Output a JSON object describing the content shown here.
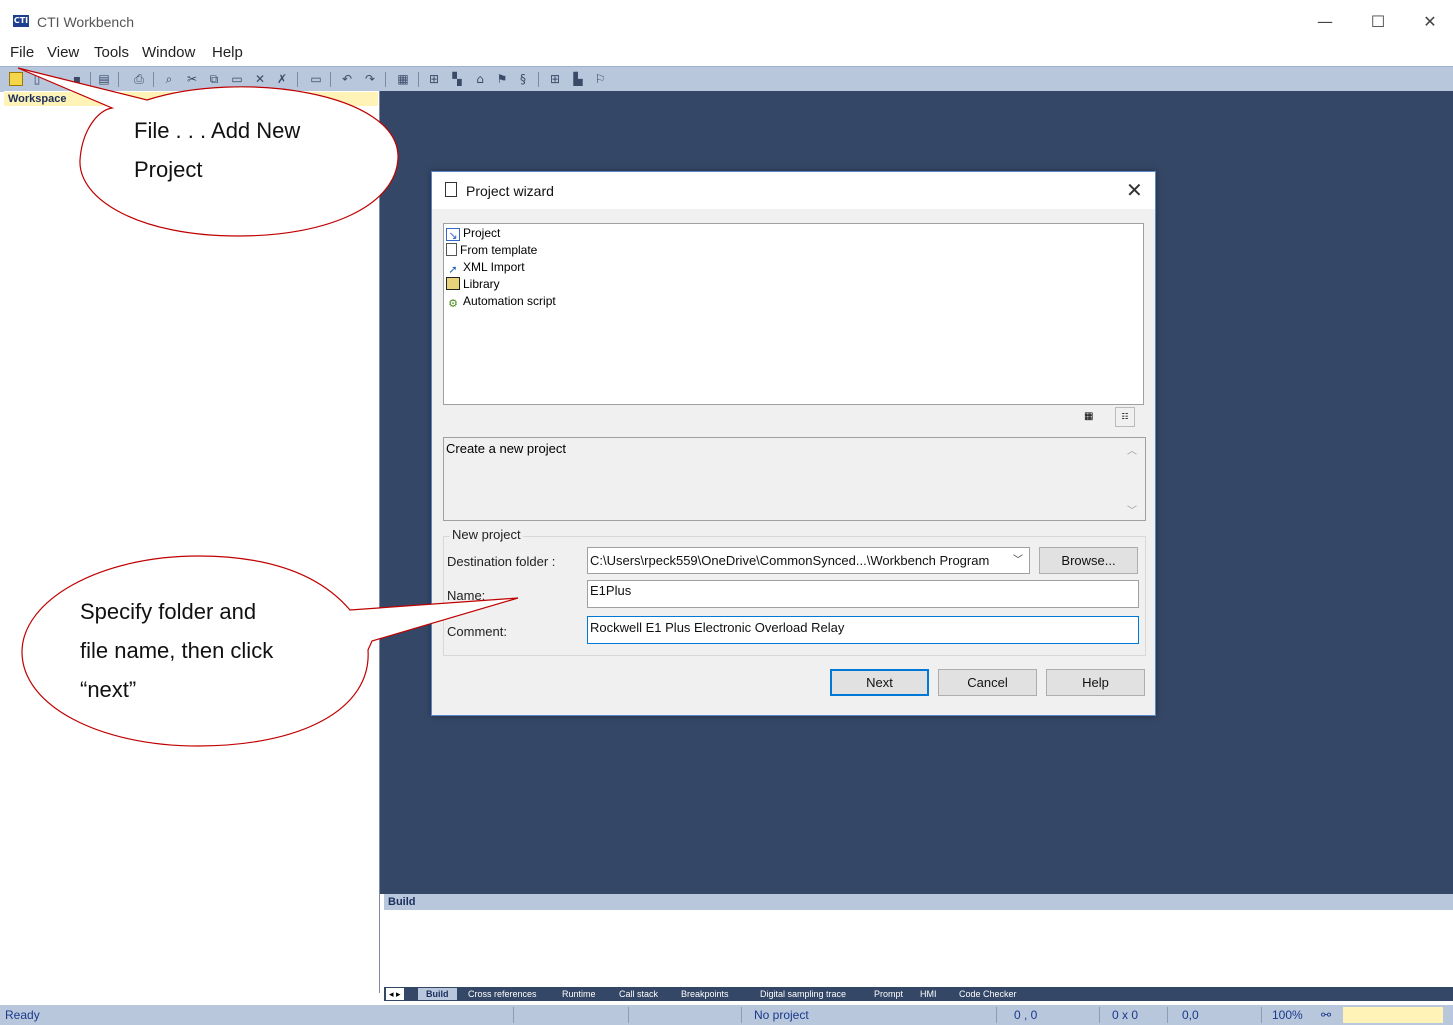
{
  "app": {
    "title": "CTI Workbench"
  },
  "window_controls": {
    "minimize": "—",
    "maximize": "☐",
    "close": "✕"
  },
  "menu": [
    "File",
    "View",
    "Tools",
    "Window",
    "Help"
  ],
  "workspace": {
    "header": "Workspace"
  },
  "build": {
    "header": "Build",
    "tabs": [
      "Build",
      "Cross references",
      "Runtime",
      "Call stack",
      "Breakpoints",
      "Digital sampling trace",
      "Prompt",
      "HMI",
      "Code Checker"
    ],
    "active_tab": "Build"
  },
  "status": {
    "ready": "Ready",
    "project": "No project",
    "coords": "0 , 0",
    "size": "0 x 0",
    "pos": "0,0",
    "zoom": "100%"
  },
  "dialog": {
    "title": "Project wizard",
    "items": [
      {
        "label": "Project",
        "icon": "project-wizard-icon"
      },
      {
        "label": "From template",
        "icon": "template-icon"
      },
      {
        "label": "XML Import",
        "icon": "xml-import-icon"
      },
      {
        "label": "Library",
        "icon": "library-icon"
      },
      {
        "label": "Automation script",
        "icon": "automation-script-icon"
      }
    ],
    "selected_item": "Project",
    "description": "Create a new project",
    "group_title": "New project",
    "destination_label": "Destination folder :",
    "destination_value": "C:\\Users\\rpeck559\\OneDrive\\CommonSynced...\\Workbench Program",
    "browse_label": "Browse...",
    "name_label": "Name:",
    "name_value": "E1Plus",
    "comment_label": "Comment:",
    "comment_value": "Rockwell E1 Plus Electronic Overload Relay",
    "next_label": "Next",
    "cancel_label": "Cancel",
    "help_label": "Help"
  },
  "callouts": {
    "top": [
      "File . . . Add New",
      "Project"
    ],
    "bottom": [
      "Specify folder and",
      "file name, then click",
      "“next”"
    ]
  },
  "colors": {
    "mdi_background": "#344766",
    "toolbar": "#b9c7dd",
    "workspace_header": "#fff3b8",
    "callout_stroke": "#c00000"
  }
}
